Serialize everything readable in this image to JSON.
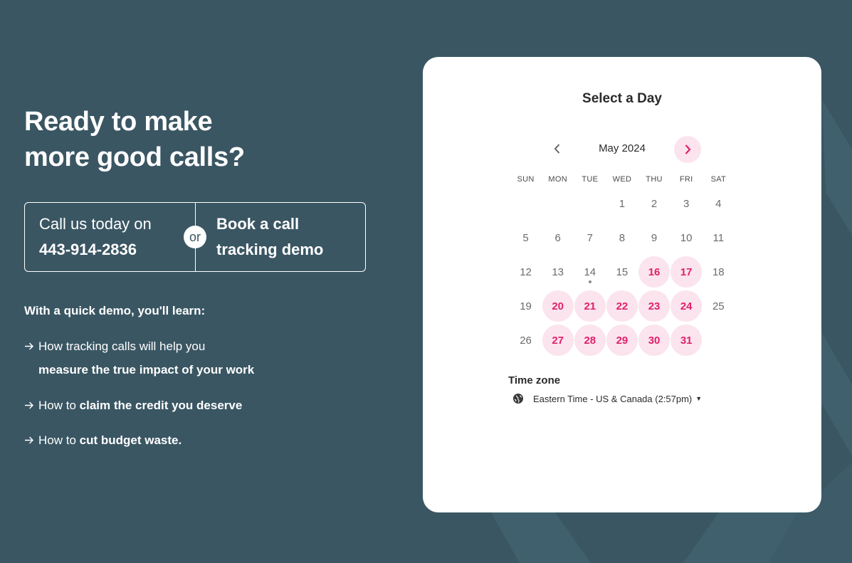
{
  "colors": {
    "background": "#3a5663",
    "accent": "#e0216a",
    "available_bg": "#fbe4ee",
    "card": "#ffffff"
  },
  "left": {
    "headline": [
      "Ready to make",
      "more good calls?"
    ],
    "cta": {
      "call_label": "Call us today on",
      "phone": "443-914-2836",
      "or_label": "or",
      "book_demo": [
        "Book a call",
        "tracking demo"
      ]
    },
    "learn_title": "With a quick demo, you'll learn:",
    "bullets": [
      {
        "icon": "arrow-right-icon",
        "line1_plain": "How tracking calls will help you",
        "line2_bold": "measure the true impact of your work"
      },
      {
        "icon": "arrow-right-icon",
        "plain": "How to ",
        "bold": "claim the credit you deserve"
      },
      {
        "icon": "arrow-right-icon",
        "plain": "How to ",
        "bold": "cut budget waste."
      }
    ]
  },
  "calendar": {
    "title": "Select a Day",
    "month_label": "May 2024",
    "weekdays": [
      "SUN",
      "MON",
      "TUE",
      "WED",
      "THU",
      "FRI",
      "SAT"
    ],
    "weeks": [
      [
        null,
        null,
        null,
        "1",
        "2",
        "3",
        "4"
      ],
      [
        "5",
        "6",
        "7",
        "8",
        "9",
        "10",
        "11"
      ],
      [
        "12",
        "13",
        "14",
        "15",
        "16",
        "17",
        "18"
      ],
      [
        "19",
        "20",
        "21",
        "22",
        "23",
        "24",
        "25"
      ],
      [
        "26",
        "27",
        "28",
        "29",
        "30",
        "31",
        null
      ]
    ],
    "available_days": [
      "16",
      "17",
      "20",
      "21",
      "22",
      "23",
      "24",
      "27",
      "28",
      "29",
      "30",
      "31"
    ],
    "today": "14",
    "timezone_label": "Time zone",
    "timezone_value": "Eastern Time - US & Canada (2:57pm)"
  }
}
